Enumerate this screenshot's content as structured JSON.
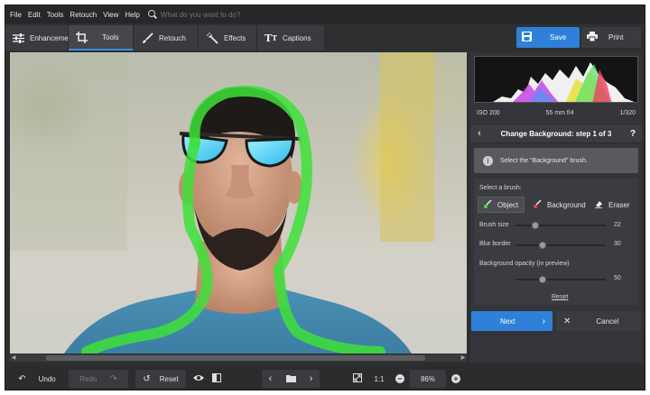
{
  "menu": [
    "File",
    "Edit",
    "Tools",
    "Retouch",
    "View",
    "Help"
  ],
  "search": {
    "placeholder": "What do you want to do?"
  },
  "tabs": [
    {
      "label": "Enhancement",
      "icon": "sliders-icon"
    },
    {
      "label": "Tools",
      "icon": "crop-icon"
    },
    {
      "label": "Retouch",
      "icon": "brush-icon"
    },
    {
      "label": "Effects",
      "icon": "magic-wand-icon"
    },
    {
      "label": "Captions",
      "icon": "text-icon"
    }
  ],
  "save_label": "Save",
  "print_label": "Print",
  "exif": {
    "iso": "ISO 200",
    "lens": "55 mm f/4",
    "shutter": "1/320"
  },
  "panel": {
    "title": "Change Background: step 1 of 3",
    "tip": "Select the \"Background\" brush.",
    "select_brush_label": "Select a brush:",
    "brushes": [
      "Object",
      "Background",
      "Eraser"
    ],
    "brush_size": {
      "label": "Brush size",
      "value": "22",
      "fraction": 0.22
    },
    "blur_border": {
      "label": "Blur border",
      "value": "30",
      "fraction": 0.3
    },
    "bg_opacity": {
      "label": "Background opacity (in preview)",
      "value": "50",
      "fraction": 0.3
    },
    "reset_link": "Reset"
  },
  "next_label": "Next",
  "cancel_label": "Cancel",
  "bottom": {
    "undo": "Undo",
    "redo": "Redo",
    "reset": "Reset",
    "zoom_ratio": "1:1",
    "zoom": "86%"
  },
  "colors": {
    "accent": "#2f80d8",
    "selection": "#3ee03a"
  }
}
